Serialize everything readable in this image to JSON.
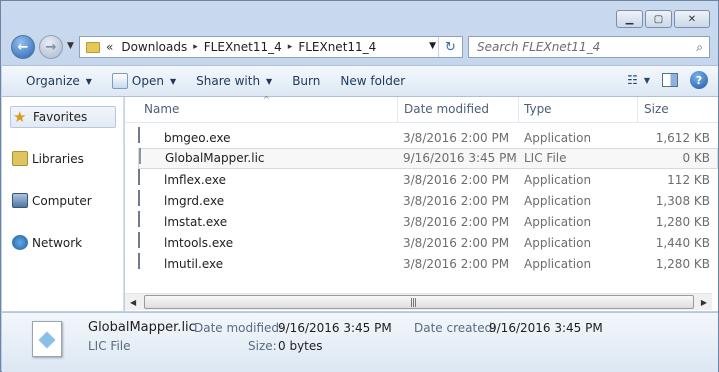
{
  "window": {
    "minimize_glyph": "▁",
    "maximize_glyph": "▢",
    "close_glyph": "✕"
  },
  "address": {
    "chevron": "«",
    "crumbs": [
      "Downloads",
      "FLEXnet11_4",
      "FLEXnet11_4"
    ],
    "sep": "▸",
    "dropdown_glyph": "▼",
    "refresh_glyph": "↻"
  },
  "search": {
    "placeholder": "Search FLEXnet11_4",
    "icon": "search-icon",
    "icon_glyph": "⌕"
  },
  "toolbar": {
    "organize": "Organize",
    "open": "Open",
    "share_with": "Share with",
    "burn": "Burn",
    "new_folder": "New folder",
    "dropdown_glyph": "▼",
    "help_glyph": "?"
  },
  "navpane": {
    "favorites": "Favorites",
    "libraries": "Libraries",
    "computer": "Computer",
    "network": "Network",
    "star_glyph": "★"
  },
  "columns": {
    "name": "Name",
    "date": "Date modified",
    "type": "Type",
    "size": "Size",
    "sort_glyph": "^"
  },
  "files": [
    {
      "name": "bmgeo.exe",
      "date": "3/8/2016 2:00 PM",
      "type": "Application",
      "size": "1,612 KB",
      "icon": "exe-icon"
    },
    {
      "name": "GlobalMapper.lic",
      "date": "9/16/2016 3:45 PM",
      "type": "LIC File",
      "size": "0 KB",
      "icon": "lic-file-icon",
      "selected": true
    },
    {
      "name": "lmflex.exe",
      "date": "3/8/2016 2:00 PM",
      "type": "Application",
      "size": "112 KB",
      "icon": "exe-icon"
    },
    {
      "name": "lmgrd.exe",
      "date": "3/8/2016 2:00 PM",
      "type": "Application",
      "size": "1,308 KB",
      "icon": "exe-icon"
    },
    {
      "name": "lmstat.exe",
      "date": "3/8/2016 2:00 PM",
      "type": "Application",
      "size": "1,280 KB",
      "icon": "exe-icon"
    },
    {
      "name": "lmtools.exe",
      "date": "3/8/2016 2:00 PM",
      "type": "Application",
      "size": "1,440 KB",
      "icon": "tools-exe-icon"
    },
    {
      "name": "lmutil.exe",
      "date": "3/8/2016 2:00 PM",
      "type": "Application",
      "size": "1,280 KB",
      "icon": "exe-icon"
    }
  ],
  "scrollbar": {
    "left_glyph": "◀",
    "right_glyph": "▶",
    "grip_glyph": "|||"
  },
  "details": {
    "filename": "GlobalMapper.lic",
    "filetype": "LIC File",
    "date_modified_label": "Date modified:",
    "date_modified": "9/16/2016 3:45 PM",
    "date_created_label": "Date created:",
    "date_created": "9/16/2016 3:45 PM",
    "size_label": "Size:",
    "size": "0 bytes"
  }
}
